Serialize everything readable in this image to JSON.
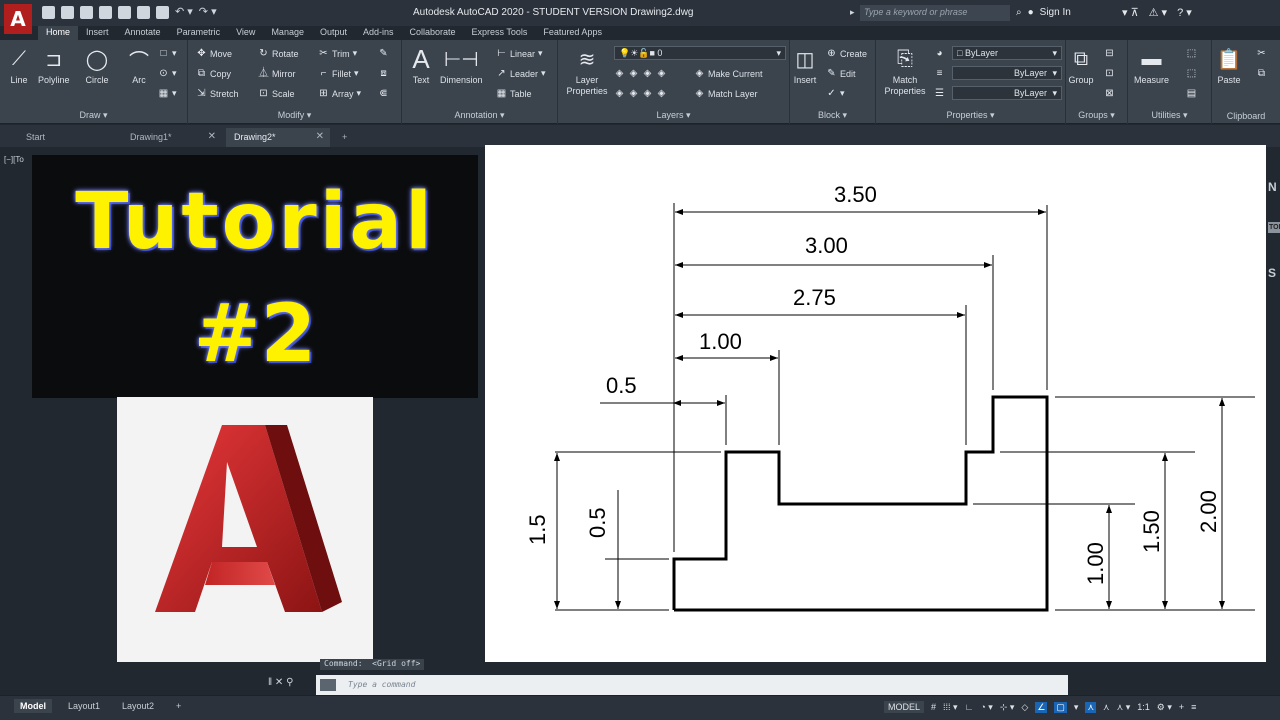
{
  "app": {
    "logo_letter": "A",
    "window_title": "Autodesk AutoCAD 2020 - STUDENT VERSION    Drawing2.dwg",
    "search_placeholder": "Type a keyword or phrase",
    "sign_in": "Sign In"
  },
  "ribbon_tabs": [
    "Home",
    "Insert",
    "Annotate",
    "Parametric",
    "View",
    "Manage",
    "Output",
    "Add-ins",
    "Collaborate",
    "Express Tools",
    "Featured Apps"
  ],
  "ribbon": {
    "draw": {
      "label": "Draw ▾",
      "line": "Line",
      "polyline": "Polyline",
      "circle": "Circle",
      "arc": "Arc"
    },
    "modify": {
      "label": "Modify ▾",
      "move": "Move",
      "rotate": "Rotate",
      "trim": "Trim",
      "copy": "Copy",
      "mirror": "Mirror",
      "fillet": "Fillet",
      "stretch": "Stretch",
      "scale": "Scale",
      "array": "Array"
    },
    "annotation": {
      "label": "Annotation ▾",
      "text": "Text",
      "dimension": "Dimension",
      "linear": "Linear",
      "leader": "Leader",
      "table": "Table"
    },
    "layers": {
      "label": "Layers ▾",
      "layer_properties": "Layer Properties",
      "layer_value": "0",
      "make_current": "Make Current",
      "match_layer": "Match Layer"
    },
    "block": {
      "label": "Block ▾",
      "insert": "Insert",
      "create": "Create",
      "edit": "Edit"
    },
    "properties": {
      "label": "Properties ▾",
      "match_properties": "Match Properties",
      "color": "ByLayer",
      "linetype": "ByLayer",
      "lineweight": "ByLayer"
    },
    "groups": {
      "label": "Groups ▾",
      "group": "Group"
    },
    "utilities": {
      "label": "Utilities ▾",
      "measure": "Measure"
    },
    "clipboard": {
      "label": "Clipboard",
      "paste": "Paste"
    }
  },
  "doc_tabs": [
    {
      "label": "Start"
    },
    {
      "label": "Drawing1*"
    },
    {
      "label": "Drawing2*"
    }
  ],
  "viewport_label": "[−][To",
  "thumbnail": {
    "line1": "Tutorial",
    "line2": "#2",
    "logo_letter": "A"
  },
  "drawing": {
    "dims_horizontal": [
      "3.50",
      "3.00",
      "2.75",
      "1.00",
      "0.5"
    ],
    "dims_left": [
      "1.5",
      "0.5"
    ],
    "dims_right": [
      "1.00",
      "1.50",
      "2.00"
    ]
  },
  "right_strip": [
    "N",
    "TOP",
    "S"
  ],
  "command": {
    "history": "Command:  <Grid off>",
    "placeholder": "Type a command"
  },
  "status": {
    "layouts": [
      "Model",
      "Layout1",
      "Layout2"
    ],
    "model_label": "MODEL",
    "scale": "1:1"
  },
  "colors": {
    "accent_red": "#b11e1e",
    "thumbnail_text": "#fff200",
    "ribbon_bg": "#3b434d",
    "canvas_bg": "#212830"
  }
}
